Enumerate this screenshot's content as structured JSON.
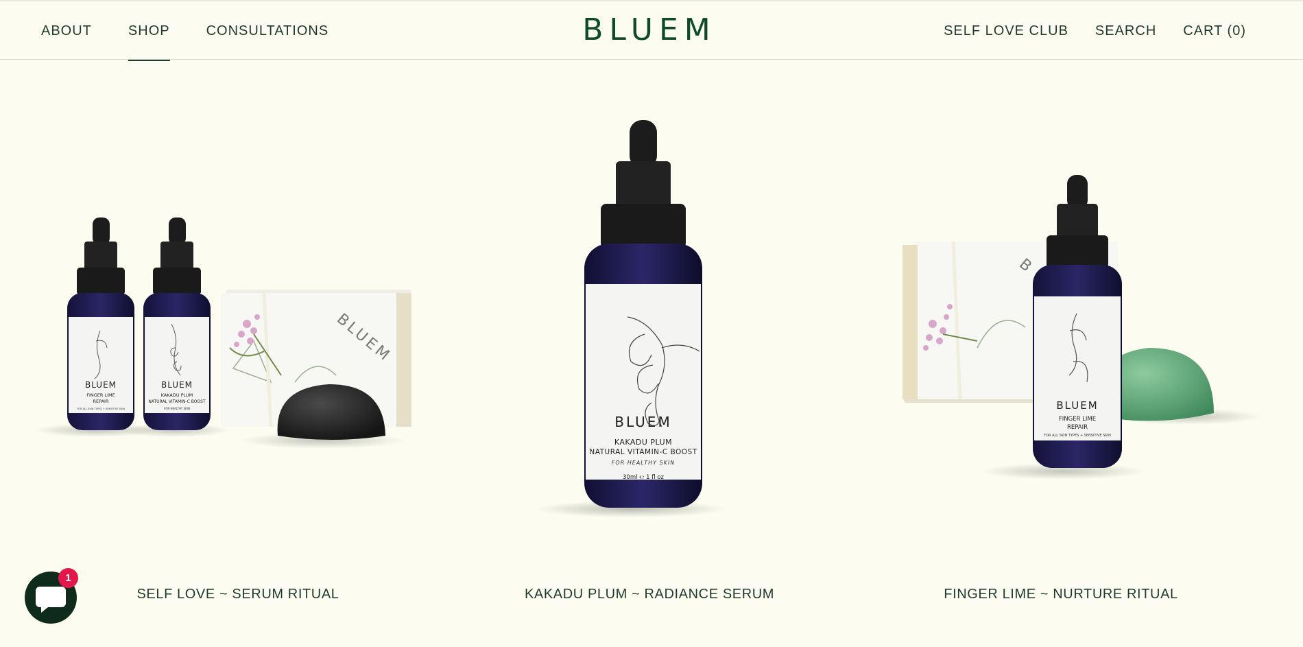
{
  "header": {
    "logo": "BLUEM",
    "nav_left": [
      "ABOUT",
      "SHOP",
      "CONSULTATIONS"
    ],
    "nav_right": [
      "SELF LOVE CLUB",
      "SEARCH",
      "CART (0)"
    ],
    "active": "SHOP"
  },
  "products": [
    {
      "title": "SELF LOVE ~ SERUM RITUAL",
      "bottle_1": {
        "brand": "BLUEM",
        "name_line1": "FINGER LIME",
        "name_line2": "REPAIR",
        "small": "FOR ALL SKIN TYPES + SENSITIVE SKIN",
        "volume": "30ml ℮ 1 fl oz"
      },
      "bottle_2": {
        "brand": "BLUEM",
        "name_line1": "KAKADU PLUM",
        "name_line2": "NATURAL VITAMIN-C BOOST",
        "small": "FOR HEALTHY SKIN",
        "volume": "30ml ℮ 1 fl oz"
      },
      "soap_brand": "BLUEM"
    },
    {
      "title": "KAKADU PLUM ~ RADIANCE SERUM",
      "bottle": {
        "brand": "BLUEM",
        "name_line1": "KAKADU PLUM",
        "name_line2": "NATURAL VITAMIN-C BOOST",
        "small": "FOR HEALTHY SKIN",
        "volume": "30ml ℮ 1 fl oz"
      }
    },
    {
      "title": "FINGER LIME ~ NURTURE RITUAL",
      "bottle": {
        "brand": "BLUEM",
        "name_line1": "FINGER LIME",
        "name_line2": "REPAIR",
        "small": "FOR ALL SKIN TYPES + SENSITIVE SKIN",
        "volume": "30ml ℮ 1 fl oz"
      },
      "soap_brand": "B"
    }
  ],
  "chat": {
    "badge": "1"
  },
  "colors": {
    "background": "#FCFDF0",
    "text": "#1F3A2C",
    "logo": "#0E4A2A",
    "badge": "#E3174A",
    "chat": "#0F2B1C"
  }
}
